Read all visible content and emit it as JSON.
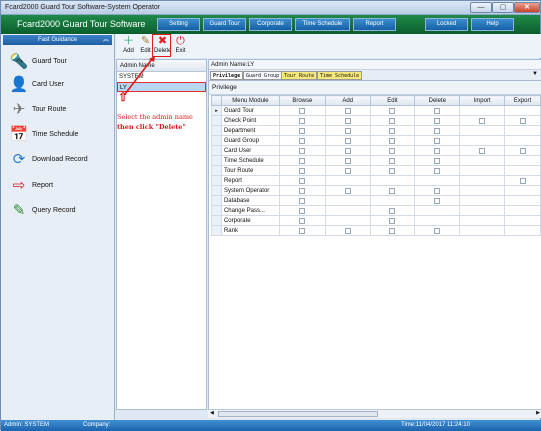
{
  "window": {
    "title": "Fcard2000 Guard Tour Software-System Operator",
    "controls": [
      "—",
      "▢",
      "✕"
    ]
  },
  "menubar": {
    "app_name": "Fcard2000 Guard Tour Software",
    "items": [
      "Setting",
      "Guard Tour",
      "Corporate",
      "Time Schedule",
      "Report",
      "Locked",
      "Help"
    ]
  },
  "sidebar": {
    "header": "Fast Guidance",
    "items": [
      {
        "label": "Guard Tour",
        "icon": "guard-icon"
      },
      {
        "label": "Card User",
        "icon": "user-icon"
      },
      {
        "label": "Tour Route",
        "icon": "route-icon"
      },
      {
        "label": "Time Schedule",
        "icon": "calendar-icon"
      },
      {
        "label": "Download Record",
        "icon": "download-icon"
      },
      {
        "label": "Report",
        "icon": "report-icon"
      },
      {
        "label": "Query Record",
        "icon": "query-icon"
      }
    ]
  },
  "toolbar": {
    "add": "Add",
    "edit": "Edit",
    "delete": "Delete",
    "exit": "Exit"
  },
  "admin_list": {
    "header": "Admin Name",
    "rows": [
      "SYSTEM",
      "LY"
    ]
  },
  "annotation": {
    "line1": "Select the admin name",
    "line2": "then click \"Delete\""
  },
  "detail": {
    "admin_name_label": "Admin Name:LY",
    "tabs": [
      "Privilege",
      "Guard Group",
      "Tour Route",
      "Time Schedule"
    ],
    "privilege_label": "Privilege",
    "columns": [
      "Menu Module",
      "Browse",
      "Add",
      "Edit",
      "Delete",
      "Import",
      "Export"
    ],
    "rows": [
      {
        "module": "Guard Tour",
        "cb": [
          1,
          1,
          1,
          1,
          0,
          0
        ]
      },
      {
        "module": "Check Point",
        "cb": [
          1,
          1,
          1,
          1,
          1,
          1
        ]
      },
      {
        "module": "Department",
        "cb": [
          1,
          1,
          1,
          1,
          0,
          0
        ]
      },
      {
        "module": "Guard Group",
        "cb": [
          1,
          1,
          1,
          1,
          0,
          0
        ]
      },
      {
        "module": "Card User",
        "cb": [
          1,
          1,
          1,
          1,
          1,
          1
        ]
      },
      {
        "module": "Time Schedule",
        "cb": [
          1,
          1,
          1,
          1,
          0,
          0
        ]
      },
      {
        "module": "Tour Route",
        "cb": [
          1,
          1,
          1,
          1,
          0,
          0
        ]
      },
      {
        "module": "Report",
        "cb": [
          1,
          0,
          0,
          0,
          0,
          1
        ]
      },
      {
        "module": "System Operator",
        "cb": [
          1,
          1,
          1,
          1,
          0,
          0
        ]
      },
      {
        "module": "Database",
        "cb": [
          1,
          0,
          0,
          1,
          0,
          0
        ]
      },
      {
        "module": "Change Pass...",
        "cb": [
          1,
          0,
          1,
          0,
          0,
          0
        ]
      },
      {
        "module": "Corporate",
        "cb": [
          1,
          0,
          1,
          0,
          0,
          0
        ]
      },
      {
        "module": "Rank",
        "cb": [
          1,
          1,
          1,
          1,
          0,
          0
        ]
      }
    ]
  },
  "statusbar": {
    "admin": "Admin: SYSTEM",
    "company": "Company:",
    "time": "Time:11/04/2017 11:24:10"
  }
}
